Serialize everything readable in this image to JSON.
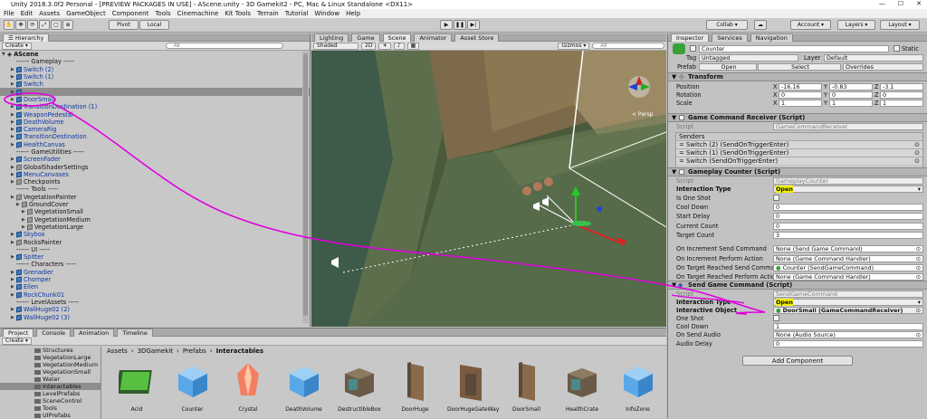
{
  "window": {
    "title": "Unity 2018.3.0f2 Personal - [PREVIEW PACKAGES IN USE] - AScene.unity - 3D Gamekit2 - PC, Mac & Linux Standalone <DX11>"
  },
  "menu": [
    "File",
    "Edit",
    "Assets",
    "GameObject",
    "Component",
    "Tools",
    "Cinemachine",
    "Kit Tools",
    "Terrain",
    "Tutorial",
    "Window",
    "Help"
  ],
  "toolbar": {
    "pivot": "Pivot",
    "local": "Local",
    "collab": "Collab ▾",
    "account": "Account ▾",
    "layers": "Layers ▾",
    "layout": "Layout ▾"
  },
  "hierarchy": {
    "tab": "Hierarchy",
    "create": "Create ▾",
    "search_placeholder": "All",
    "scene": "AScene",
    "items": [
      {
        "label": "------ Gameplay -----",
        "indent": 2,
        "icon": "none",
        "blue": false
      },
      {
        "label": "Switch (2)",
        "indent": 1,
        "icon": "blue",
        "blue": true
      },
      {
        "label": "Switch (1)",
        "indent": 1,
        "icon": "blue",
        "blue": true
      },
      {
        "label": "Switch",
        "indent": 1,
        "icon": "blue",
        "blue": true
      },
      {
        "label": "",
        "indent": 1,
        "icon": "blue",
        "blue": true,
        "selected": true
      },
      {
        "label": "DoorSmall",
        "indent": 1,
        "icon": "blue",
        "blue": true
      },
      {
        "label": "TransitionDestination (1)",
        "indent": 1,
        "icon": "blue",
        "blue": true
      },
      {
        "label": "WeaponPedestal",
        "indent": 1,
        "icon": "blue",
        "blue": true
      },
      {
        "label": "DeathVolume",
        "indent": 1,
        "icon": "blue",
        "blue": true
      },
      {
        "label": "CameraRig",
        "indent": 1,
        "icon": "blue",
        "blue": true
      },
      {
        "label": "TransitionDestination",
        "indent": 1,
        "icon": "blue",
        "blue": true
      },
      {
        "label": "HealthCanvas",
        "indent": 1,
        "icon": "blue",
        "blue": true
      },
      {
        "label": "------ GameUtilities -----",
        "indent": 2,
        "icon": "none",
        "blue": false
      },
      {
        "label": "ScreenFader",
        "indent": 1,
        "icon": "blue",
        "blue": true
      },
      {
        "label": "GlobalShaderSettings",
        "indent": 1,
        "icon": "gray",
        "blue": false
      },
      {
        "label": "MenuCanvases",
        "indent": 1,
        "icon": "blue",
        "blue": true
      },
      {
        "label": "Checkpoints",
        "indent": 1,
        "icon": "gray",
        "blue": false
      },
      {
        "label": "------ Tools -----",
        "indent": 2,
        "icon": "none",
        "blue": false
      },
      {
        "label": "VegetationPainter",
        "indent": 1,
        "icon": "gray",
        "blue": false
      },
      {
        "label": "GroundCover",
        "indent": 2,
        "icon": "gray",
        "blue": false
      },
      {
        "label": "VegetationSmall",
        "indent": 3,
        "icon": "gray",
        "blue": false
      },
      {
        "label": "VegetationMedium",
        "indent": 3,
        "icon": "gray",
        "blue": false
      },
      {
        "label": "VegetationLarge",
        "indent": 3,
        "icon": "gray",
        "blue": false
      },
      {
        "label": "Skybox",
        "indent": 1,
        "icon": "blue",
        "blue": true
      },
      {
        "label": "RocksPainter",
        "indent": 1,
        "icon": "gray",
        "blue": false
      },
      {
        "label": "------ UI -----",
        "indent": 2,
        "icon": "none",
        "blue": false
      },
      {
        "label": "Spitter",
        "indent": 1,
        "icon": "blue",
        "blue": true
      },
      {
        "label": "------ Characters -----",
        "indent": 2,
        "icon": "none",
        "blue": false
      },
      {
        "label": "Grenadier",
        "indent": 1,
        "icon": "blue",
        "blue": true
      },
      {
        "label": "Chomper",
        "indent": 1,
        "icon": "blue",
        "blue": true
      },
      {
        "label": "Ellen",
        "indent": 1,
        "icon": "blue",
        "blue": true
      },
      {
        "label": "RockChunk01",
        "indent": 1,
        "icon": "blue",
        "blue": true
      },
      {
        "label": "------ LevelAssets -----",
        "indent": 2,
        "icon": "none",
        "blue": false
      },
      {
        "label": "WallHuge02 (2)",
        "indent": 1,
        "icon": "blue",
        "blue": true
      },
      {
        "label": "WallHuge02 (3)",
        "indent": 1,
        "icon": "blue",
        "blue": true
      }
    ]
  },
  "scene_view": {
    "tabs": [
      "Lighting",
      "Game",
      "Scene",
      "Animator",
      "Asset Store"
    ],
    "shading": "Shaded",
    "mode": "2D",
    "gizmos": "Gizmos ▾",
    "search_placeholder": "All",
    "persp": "< Persp"
  },
  "inspector": {
    "tabs": [
      "Inspector",
      "Services",
      "Navigation"
    ],
    "object_name": "Counter",
    "static_label": "Static",
    "tag_label": "Tag",
    "tag_value": "Untagged",
    "layer_label": "Layer",
    "layer_value": "Default",
    "prefab_label": "Prefab",
    "prefab_open": "Open",
    "prefab_select": "Select",
    "prefab_overrides": "Overrides",
    "transform": {
      "title": "Transform",
      "position": "Position",
      "rotation": "Rotation",
      "scale": "Scale",
      "pos": {
        "x": "-16.16",
        "y": "-0.83",
        "z": "-3.1"
      },
      "rot": {
        "x": "0",
        "y": "0",
        "z": "0"
      },
      "scl": {
        "x": "1",
        "y": "1",
        "z": "1"
      }
    },
    "receiver": {
      "title": "Game Command Receiver (Script)",
      "script_label": "Script",
      "script_value": "GameCommandReceiver",
      "senders_label": "Senders",
      "senders": [
        "Switch (2) (SendOnTriggerEnter)",
        "Switch (1) (SendOnTriggerEnter)",
        "Switch (SendOnTriggerEnter)"
      ]
    },
    "counter": {
      "title": "Gameplay Counter (Script)",
      "script_label": "Script",
      "script_value": "GameplayCounter",
      "rows": [
        {
          "label": "Interaction Type",
          "value": "Open",
          "bold": true
        },
        {
          "label": "Is One Shot",
          "value": "",
          "check": true
        },
        {
          "label": "Cool Down",
          "value": "0"
        },
        {
          "label": "Start Delay",
          "value": "0"
        },
        {
          "label": "Current Count",
          "value": "0"
        },
        {
          "label": "Target Count",
          "value": "3"
        },
        {
          "label": "On Increment Send Command",
          "value": "None (Send Game Command)"
        },
        {
          "label": "On Increment Perform Action",
          "value": "None (Game Command Handler)"
        },
        {
          "label": "On Target Reached Send Command",
          "value": "Counter (SendGameCommand)"
        },
        {
          "label": "On Target Reached Perform Action",
          "value": "None (Game Command Handler)"
        }
      ]
    },
    "send": {
      "title": "Send Game Command (Script)",
      "script_label": "Script",
      "script_value": "SendGameCommand",
      "rows": [
        {
          "label": "Interaction Type",
          "value": "Open",
          "bold": true
        },
        {
          "label": "Interactive Object",
          "value": "DoorSmall (GameCommandReceiver)",
          "bold": true
        },
        {
          "label": "One Shot",
          "value": "",
          "check": true
        },
        {
          "label": "Cool Down",
          "value": "1"
        },
        {
          "label": "On Send Audio",
          "value": "None (Audio Source)"
        },
        {
          "label": "Audio Delay",
          "value": "0"
        }
      ]
    },
    "add_component": "Add Component"
  },
  "project": {
    "tabs": [
      "Project",
      "Console",
      "Animation",
      "Timeline"
    ],
    "create": "Create ▾",
    "breadcrumb": [
      "Assets",
      "3DGamekit",
      "Prefabs",
      "Interactables"
    ],
    "folders": [
      "Structures",
      "VegetationLarge",
      "VegetationMedium",
      "VegetationSmall",
      "Water",
      "Interactables",
      "LevelPrefabs",
      "SceneControl",
      "Tools",
      "UIPrefabs"
    ],
    "assets": [
      {
        "name": "Acid",
        "kind": "acid"
      },
      {
        "name": "Counter",
        "kind": "cube"
      },
      {
        "name": "Crystal",
        "kind": "crystal"
      },
      {
        "name": "DeathVolume",
        "kind": "cube"
      },
      {
        "name": "DestructibleBox",
        "kind": "box"
      },
      {
        "name": "DoorHuge",
        "kind": "door"
      },
      {
        "name": "DoorHugeGateWay",
        "kind": "gate"
      },
      {
        "name": "DoorSmall",
        "kind": "door"
      },
      {
        "name": "HealthCrate",
        "kind": "box"
      },
      {
        "name": "InfoZone",
        "kind": "cube"
      }
    ]
  },
  "colors": {
    "annotation": "#e000e0",
    "highlight": "#f2f200",
    "blue_text": "#0b37a0"
  }
}
